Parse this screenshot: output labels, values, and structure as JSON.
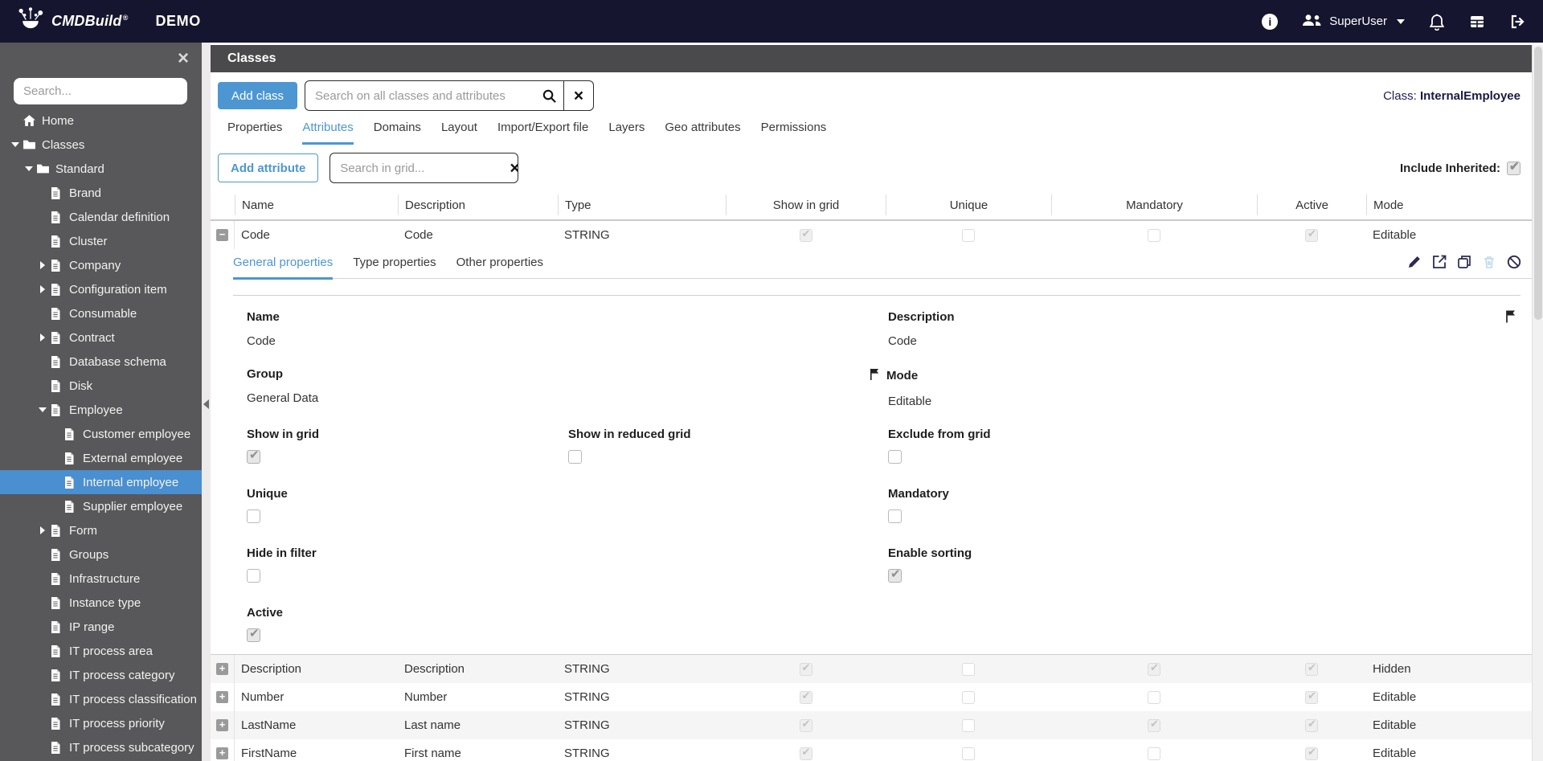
{
  "topbar": {
    "brand": "CMDBuild",
    "trademark": "®",
    "title": "DEMO",
    "user": "SuperUser"
  },
  "sidebar": {
    "search_placeholder": "Search...",
    "tree": [
      {
        "label": "Home",
        "icon": "home",
        "level": 0,
        "caret": "none"
      },
      {
        "label": "Classes",
        "icon": "folder",
        "level": 0,
        "caret": "down"
      },
      {
        "label": "Standard",
        "icon": "folder",
        "level": 1,
        "caret": "down"
      },
      {
        "label": "Brand",
        "icon": "file",
        "level": 2,
        "caret": "none"
      },
      {
        "label": "Calendar definition",
        "icon": "file",
        "level": 2,
        "caret": "none"
      },
      {
        "label": "Cluster",
        "icon": "file",
        "level": 2,
        "caret": "none"
      },
      {
        "label": "Company",
        "icon": "file",
        "level": 2,
        "caret": "right"
      },
      {
        "label": "Configuration item",
        "icon": "file",
        "level": 2,
        "caret": "right"
      },
      {
        "label": "Consumable",
        "icon": "file",
        "level": 2,
        "caret": "none"
      },
      {
        "label": "Contract",
        "icon": "file",
        "level": 2,
        "caret": "right"
      },
      {
        "label": "Database schema",
        "icon": "file",
        "level": 2,
        "caret": "none"
      },
      {
        "label": "Disk",
        "icon": "file",
        "level": 2,
        "caret": "none"
      },
      {
        "label": "Employee",
        "icon": "file",
        "level": 2,
        "caret": "down"
      },
      {
        "label": "Customer employee",
        "icon": "file",
        "level": 3,
        "caret": "none"
      },
      {
        "label": "External employee",
        "icon": "file",
        "level": 3,
        "caret": "none"
      },
      {
        "label": "Internal employee",
        "icon": "file",
        "level": 3,
        "caret": "none",
        "selected": true
      },
      {
        "label": "Supplier employee",
        "icon": "file",
        "level": 3,
        "caret": "none"
      },
      {
        "label": "Form",
        "icon": "file",
        "level": 2,
        "caret": "right"
      },
      {
        "label": "Groups",
        "icon": "file",
        "level": 2,
        "caret": "none"
      },
      {
        "label": "Infrastructure",
        "icon": "file",
        "level": 2,
        "caret": "none"
      },
      {
        "label": "Instance type",
        "icon": "file",
        "level": 2,
        "caret": "none"
      },
      {
        "label": "IP range",
        "icon": "file",
        "level": 2,
        "caret": "none"
      },
      {
        "label": "IT process area",
        "icon": "file",
        "level": 2,
        "caret": "none"
      },
      {
        "label": "IT process category",
        "icon": "file",
        "level": 2,
        "caret": "none"
      },
      {
        "label": "IT process classification",
        "icon": "file",
        "level": 2,
        "caret": "none"
      },
      {
        "label": "IT process priority",
        "icon": "file",
        "level": 2,
        "caret": "none"
      },
      {
        "label": "IT process subcategory",
        "icon": "file",
        "level": 2,
        "caret": "none"
      }
    ]
  },
  "header": {
    "page_title": "Classes",
    "add_class_label": "Add class",
    "search_placeholder": "Search on all classes and attributes",
    "class_label": "Class:",
    "class_name": "InternalEmployee"
  },
  "tabs": [
    {
      "label": "Properties",
      "active": false
    },
    {
      "label": "Attributes",
      "active": true
    },
    {
      "label": "Domains",
      "active": false
    },
    {
      "label": "Layout",
      "active": false
    },
    {
      "label": "Import/Export file",
      "active": false
    },
    {
      "label": "Layers",
      "active": false
    },
    {
      "label": "Geo attributes",
      "active": false
    },
    {
      "label": "Permissions",
      "active": false
    }
  ],
  "toolbar": {
    "add_attribute_label": "Add attribute",
    "grid_search_placeholder": "Search in grid...",
    "include_inherited_label": "Include Inherited:",
    "include_inherited_checked": true
  },
  "grid": {
    "columns": [
      "Name",
      "Description",
      "Type",
      "Show in grid",
      "Unique",
      "Mandatory",
      "Active",
      "Mode"
    ],
    "expanded_row": {
      "name": "Code",
      "description": "Code",
      "type": "STRING",
      "show_in_grid": true,
      "unique": false,
      "mandatory": false,
      "active": true,
      "mode": "Editable",
      "expanded": true
    },
    "rows": [
      {
        "name": "Description",
        "description": "Description",
        "type": "STRING",
        "show_in_grid": true,
        "unique": false,
        "mandatory": true,
        "active": true,
        "mode": "Hidden",
        "expanded": false
      },
      {
        "name": "Number",
        "description": "Number",
        "type": "STRING",
        "show_in_grid": true,
        "unique": false,
        "mandatory": false,
        "active": true,
        "mode": "Editable",
        "expanded": false
      },
      {
        "name": "LastName",
        "description": "Last name",
        "type": "STRING",
        "show_in_grid": true,
        "unique": false,
        "mandatory": true,
        "active": true,
        "mode": "Editable",
        "expanded": false
      },
      {
        "name": "FirstName",
        "description": "First name",
        "type": "STRING",
        "show_in_grid": true,
        "unique": false,
        "mandatory": false,
        "active": true,
        "mode": "Editable",
        "expanded": false
      }
    ]
  },
  "detail": {
    "tabs": [
      {
        "label": "General properties",
        "active": true
      },
      {
        "label": "Type properties",
        "active": false
      },
      {
        "label": "Other properties",
        "active": false
      }
    ],
    "fields": {
      "name_label": "Name",
      "name_value": "Code",
      "description_label": "Description",
      "description_value": "Code",
      "group_label": "Group",
      "group_value": "General Data",
      "mode_label": "Mode",
      "mode_value": "Editable",
      "show_in_grid_label": "Show in grid",
      "show_in_grid_checked": true,
      "show_in_reduced_grid_label": "Show in reduced grid",
      "show_in_reduced_grid_checked": false,
      "exclude_from_grid_label": "Exclude from grid",
      "exclude_from_grid_checked": false,
      "unique_label": "Unique",
      "unique_checked": false,
      "mandatory_label": "Mandatory",
      "mandatory_checked": false,
      "hide_in_filter_label": "Hide in filter",
      "hide_in_filter_checked": false,
      "enable_sorting_label": "Enable sorting",
      "enable_sorting_checked": true,
      "active_label": "Active",
      "active_checked": true
    }
  },
  "colors": {
    "topbar_bg": "#15152f",
    "sidebar_bg": "#58585a",
    "selected_item": "#4a8fd0",
    "accent_blue": "#4c97d2",
    "header_bar": "#4a4a4c"
  }
}
